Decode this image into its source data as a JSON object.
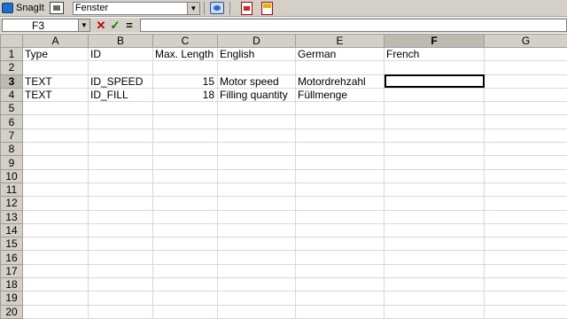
{
  "toolbar": {
    "snagit_label": "SnagIt",
    "window_select_value": "Fenster"
  },
  "formula_bar": {
    "name_box": "F3",
    "cancel_symbol": "✕",
    "enter_symbol": "✓",
    "equals_symbol": "=",
    "formula": ""
  },
  "columns": [
    "A",
    "B",
    "C",
    "D",
    "E",
    "F",
    "G"
  ],
  "rows": [
    "1",
    "2",
    "3",
    "4",
    "5",
    "6",
    "7",
    "8",
    "9",
    "10",
    "11",
    "12",
    "13",
    "14",
    "15",
    "16",
    "17",
    "18",
    "19",
    "20"
  ],
  "cells": {
    "r1": {
      "a": "Type",
      "b": "ID",
      "c": "Max. Length",
      "d": "English",
      "e": "German",
      "f": "French"
    },
    "r3": {
      "a": "TEXT",
      "b": "ID_SPEED",
      "c": "15",
      "d": "Motor speed",
      "e": "Motordrehzahl",
      "f": ""
    },
    "r4": {
      "a": "TEXT",
      "b": "ID_FILL",
      "c": "18",
      "d": "Filling quantity",
      "e": "Füllmenge",
      "f": ""
    }
  },
  "selected_cell": "F3",
  "active_column": "F",
  "active_row": "3",
  "icons": {
    "snagit": "snagit-icon",
    "capture": "capture-window-icon",
    "web": "web-capture-icon",
    "pdf": "pdf-icon",
    "pdf_edit": "pdf-edit-icon",
    "dropdown": "chevron-down-icon"
  }
}
